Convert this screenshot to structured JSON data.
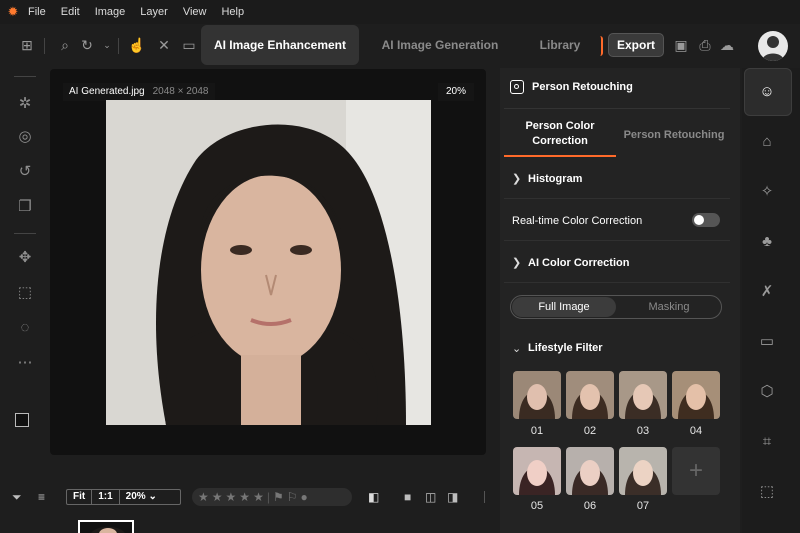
{
  "menu": [
    "File",
    "Edit",
    "Image",
    "Layer",
    "View",
    "Help"
  ],
  "toolbar": {
    "tab_enhancement": "AI Image Enhancement",
    "tab_generation": "AI Image Generation",
    "tab_library": "Library",
    "export_label": "Export"
  },
  "canvas": {
    "filename": "AI Generated.jpg",
    "dimensions": "2048 × 2048",
    "zoom": "20%"
  },
  "bottom": {
    "fit": "Fit",
    "one_to_one": "1:1",
    "zoom": "20%"
  },
  "panel": {
    "title": "Person Retouching",
    "subtab_color": "Person Color Correction",
    "subtab_retouch": "Person Retouching",
    "histogram": "Histogram",
    "realtime": "Real-time Color Correction",
    "ai_color": "AI Color Correction",
    "seg_full": "Full Image",
    "seg_mask": "Masking",
    "lifestyle": "Lifestyle Filter",
    "filters": [
      "01",
      "02",
      "03",
      "04",
      "05",
      "06",
      "07"
    ]
  },
  "colors": {
    "accent": "#ff6a2a"
  }
}
